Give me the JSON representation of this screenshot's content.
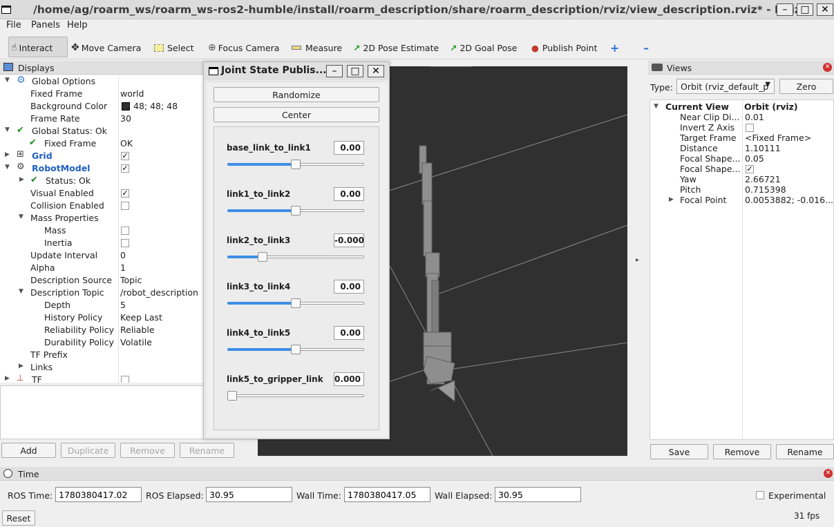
{
  "window": {
    "title": "/home/ag/roarm_ws/roarm_ws-ros2-humble/install/roarm_description/share/roarm_description/rviz/view_description.rviz* - RViz"
  },
  "menu": [
    "File",
    "Panels",
    "Help"
  ],
  "toolbar": {
    "interact": "Interact",
    "move_camera": "Move Camera",
    "select": "Select",
    "focus_camera": "Focus Camera",
    "measure": "Measure",
    "pose_estimate": "2D Pose Estimate",
    "goal_pose": "2D Goal Pose",
    "publish_point": "Publish Point"
  },
  "displays": {
    "title": "Displays",
    "tree": [
      {
        "label": "Global Options",
        "value": "",
        "kind": "header"
      },
      {
        "label": "Fixed Frame",
        "value": "world"
      },
      {
        "label": "Background Color",
        "value": "48; 48; 48",
        "swatch": "#303030"
      },
      {
        "label": "Frame Rate",
        "value": "30"
      },
      {
        "label": "Global Status: Ok",
        "value": ""
      },
      {
        "label": "Fixed Frame",
        "value": "OK"
      },
      {
        "label": "Grid",
        "value": "",
        "checked": true
      },
      {
        "label": "RobotModel",
        "value": "",
        "checked": true
      },
      {
        "label": "Status: Ok",
        "value": ""
      },
      {
        "label": "Visual Enabled",
        "value": "",
        "checked": true
      },
      {
        "label": "Collision Enabled",
        "value": "",
        "checked": false
      },
      {
        "label": "Mass Properties",
        "value": ""
      },
      {
        "label": "Mass",
        "value": "",
        "checked": false
      },
      {
        "label": "Inertia",
        "value": "",
        "checked": false
      },
      {
        "label": "Update Interval",
        "value": "0"
      },
      {
        "label": "Alpha",
        "value": "1"
      },
      {
        "label": "Description Source",
        "value": "Topic"
      },
      {
        "label": "Description Topic",
        "value": "/robot_description"
      },
      {
        "label": "Depth",
        "value": "5"
      },
      {
        "label": "History Policy",
        "value": "Keep Last"
      },
      {
        "label": "Reliability Policy",
        "value": "Reliable"
      },
      {
        "label": "Durability Policy",
        "value": "Volatile"
      },
      {
        "label": "TF Prefix",
        "value": ""
      },
      {
        "label": "Links",
        "value": ""
      },
      {
        "label": "TF",
        "value": "",
        "checked": false
      }
    ],
    "buttons": {
      "add": "Add",
      "duplicate": "Duplicate",
      "remove": "Remove",
      "rename": "Rename"
    }
  },
  "jsp": {
    "title": "Joint State Publis...",
    "randomize": "Randomize",
    "center": "Center",
    "joints": [
      {
        "name": "base_link_to_link1",
        "value": "0.00",
        "fraction": 0.5
      },
      {
        "name": "link1_to_link2",
        "value": "0.00",
        "fraction": 0.5
      },
      {
        "name": "link2_to_link3",
        "value": "-0.000",
        "fraction": 0.26
      },
      {
        "name": "link3_to_link4",
        "value": "0.00",
        "fraction": 0.5
      },
      {
        "name": "link4_to_link5",
        "value": "0.00",
        "fraction": 0.5
      },
      {
        "name": "link5_to_gripper_link",
        "value": "0.000",
        "fraction": 0.0
      }
    ]
  },
  "views": {
    "title": "Views",
    "type_label": "Type:",
    "type_value": "Orbit (rviz_default_p",
    "zero": "Zero",
    "current_view": "Current View",
    "current_view_type": "Orbit (rviz)",
    "props": [
      {
        "label": "Near Clip Di...",
        "value": "0.01"
      },
      {
        "label": "Invert Z Axis",
        "value": "",
        "checked": false
      },
      {
        "label": "Target Frame",
        "value": "<Fixed Frame>"
      },
      {
        "label": "Distance",
        "value": "1.10111"
      },
      {
        "label": "Focal Shape...",
        "value": "0.05"
      },
      {
        "label": "Focal Shape...",
        "value": "",
        "checked": true
      },
      {
        "label": "Yaw",
        "value": "2.66721"
      },
      {
        "label": "Pitch",
        "value": "0.715398"
      },
      {
        "label": "Focal Point",
        "value": "0.0053882; -0.016..."
      }
    ],
    "buttons": {
      "save": "Save",
      "remove": "Remove",
      "rename": "Rename"
    }
  },
  "time": {
    "title": "Time",
    "ros_time_label": "ROS Time:",
    "ros_time": "1780380417.02",
    "ros_elapsed_label": "ROS Elapsed:",
    "ros_elapsed": "30.95",
    "wall_time_label": "Wall Time:",
    "wall_time": "1780380417.05",
    "wall_elapsed_label": "Wall Elapsed:",
    "wall_elapsed": "30.95",
    "experimental": "Experimental",
    "reset": "Reset",
    "fps": "31 fps"
  },
  "colors": {
    "viewport_bg": "#303030",
    "accent": "#3d8ee6",
    "status_ok": "#1c8a1c",
    "blue_label": "#1f5fbf"
  }
}
